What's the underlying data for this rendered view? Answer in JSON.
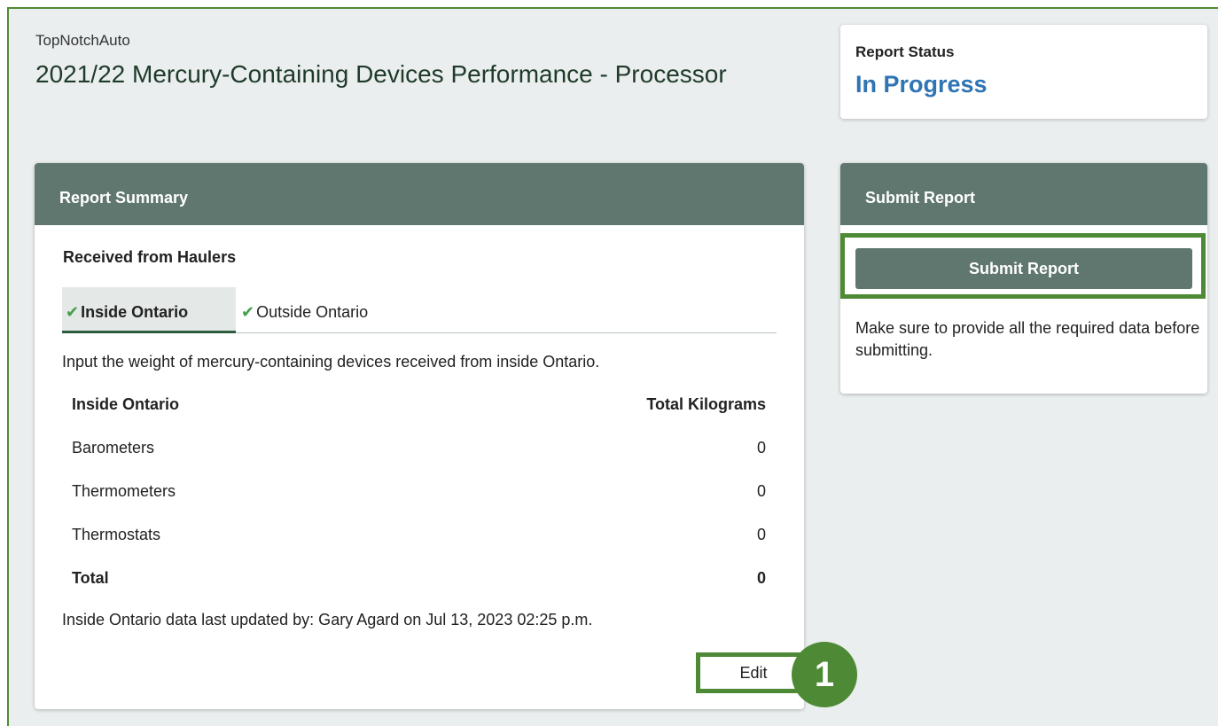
{
  "header": {
    "company": "TopNotchAuto",
    "title": "2021/22 Mercury-Containing Devices Performance - Processor"
  },
  "status": {
    "label": "Report Status",
    "value": "In Progress",
    "value_color": "#2f74b3"
  },
  "summary": {
    "header": "Report Summary",
    "section": "Received from Haulers",
    "tabs": [
      {
        "label": "Inside Ontario",
        "icon": "check-icon",
        "active": true
      },
      {
        "label": "Outside Ontario",
        "icon": "check-icon",
        "active": false
      }
    ],
    "instruction": "Input the weight of mercury-containing devices received from inside Ontario.",
    "table": {
      "col_name": "Inside Ontario",
      "col_value": "Total Kilograms",
      "rows": [
        {
          "name": "Barometers",
          "value": "0"
        },
        {
          "name": "Thermometers",
          "value": "0"
        },
        {
          "name": "Thermostats",
          "value": "0"
        }
      ],
      "total": {
        "name": "Total",
        "value": "0"
      }
    },
    "footnote": "Inside Ontario data last updated by: Gary Agard on  Jul 13, 2023 02:25 p.m.",
    "edit_label": "Edit"
  },
  "submit": {
    "header": "Submit Report",
    "button_label": "Submit Report",
    "help": "Make sure to provide all the required data before submitting."
  },
  "callout": {
    "number": "1"
  },
  "colors": {
    "accent_green": "#4e8a35",
    "header_gray_green": "#5f776e",
    "background": "#ebeeee"
  }
}
